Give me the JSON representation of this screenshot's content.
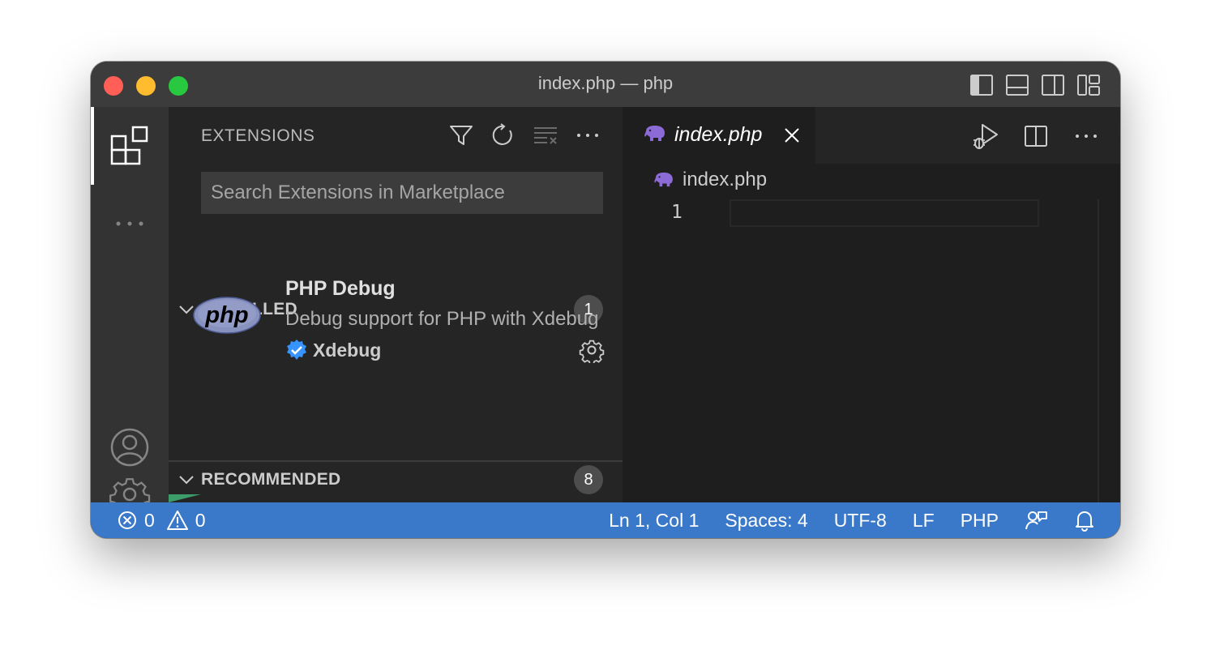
{
  "window": {
    "title": "index.php — php"
  },
  "sidebar": {
    "title": "EXTENSIONS",
    "search": {
      "placeholder": "Search Extensions in Marketplace",
      "value": ""
    },
    "installed": {
      "label": "INSTALLED",
      "count": "1",
      "items": [
        {
          "name": "PHP Debug",
          "description": "Debug support for PHP with Xdebug",
          "publisher": "Xdebug",
          "logo_text": "php",
          "verified": true
        }
      ]
    },
    "recommended": {
      "label": "RECOMMENDED",
      "count": "8"
    }
  },
  "editor": {
    "tab": {
      "label": "index.php",
      "icon": "php-elephant-icon"
    },
    "breadcrumb": "index.php",
    "line_number": "1"
  },
  "statusbar": {
    "errors": "0",
    "warnings": "0",
    "position": "Ln 1, Col 1",
    "indentation": "Spaces: 4",
    "encoding": "UTF-8",
    "eol": "LF",
    "language": "PHP"
  },
  "colors": {
    "statusbar_bg": "#3a78c9",
    "php_purple": "#8c6bd6",
    "verified_blue": "#3794ff"
  }
}
